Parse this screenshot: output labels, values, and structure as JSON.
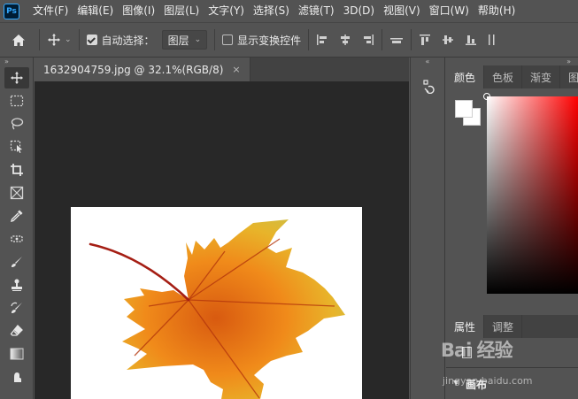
{
  "app": {
    "logo_text": "Ps"
  },
  "menu": [
    "文件(F)",
    "编辑(E)",
    "图像(I)",
    "图层(L)",
    "文字(Y)",
    "选择(S)",
    "滤镜(T)",
    "3D(D)",
    "视图(V)",
    "窗口(W)",
    "帮助(H)"
  ],
  "options_bar": {
    "auto_select_label": "自动选择：",
    "auto_select_checked": true,
    "auto_select_target": "图层",
    "show_transform_label": "显示变换控件",
    "show_transform_checked": false
  },
  "document": {
    "tab_title": "1632904759.jpg @ 32.1%(RGB/8)",
    "close_glyph": "×"
  },
  "panels": {
    "color_tabs": [
      "颜色",
      "色板",
      "渐变",
      "图案"
    ],
    "active_color_tab": "颜色",
    "foreground_color": "#ffffff",
    "background_color": "#ffffff",
    "properties_tabs": [
      "属性",
      "调整"
    ],
    "properties_canvas_label": "画布"
  },
  "watermark": {
    "main": "Bai 经验",
    "sub": "jingyan.baidu.com"
  },
  "icons": {
    "tools": [
      "move-icon",
      "marquee-icon",
      "lasso-icon",
      "object-select-icon",
      "crop-icon",
      "frame-icon",
      "eyedropper-icon",
      "healing-icon",
      "brush-icon",
      "stamp-icon",
      "history-brush-icon",
      "eraser-icon",
      "gradient-icon",
      "smudge-icon"
    ]
  }
}
